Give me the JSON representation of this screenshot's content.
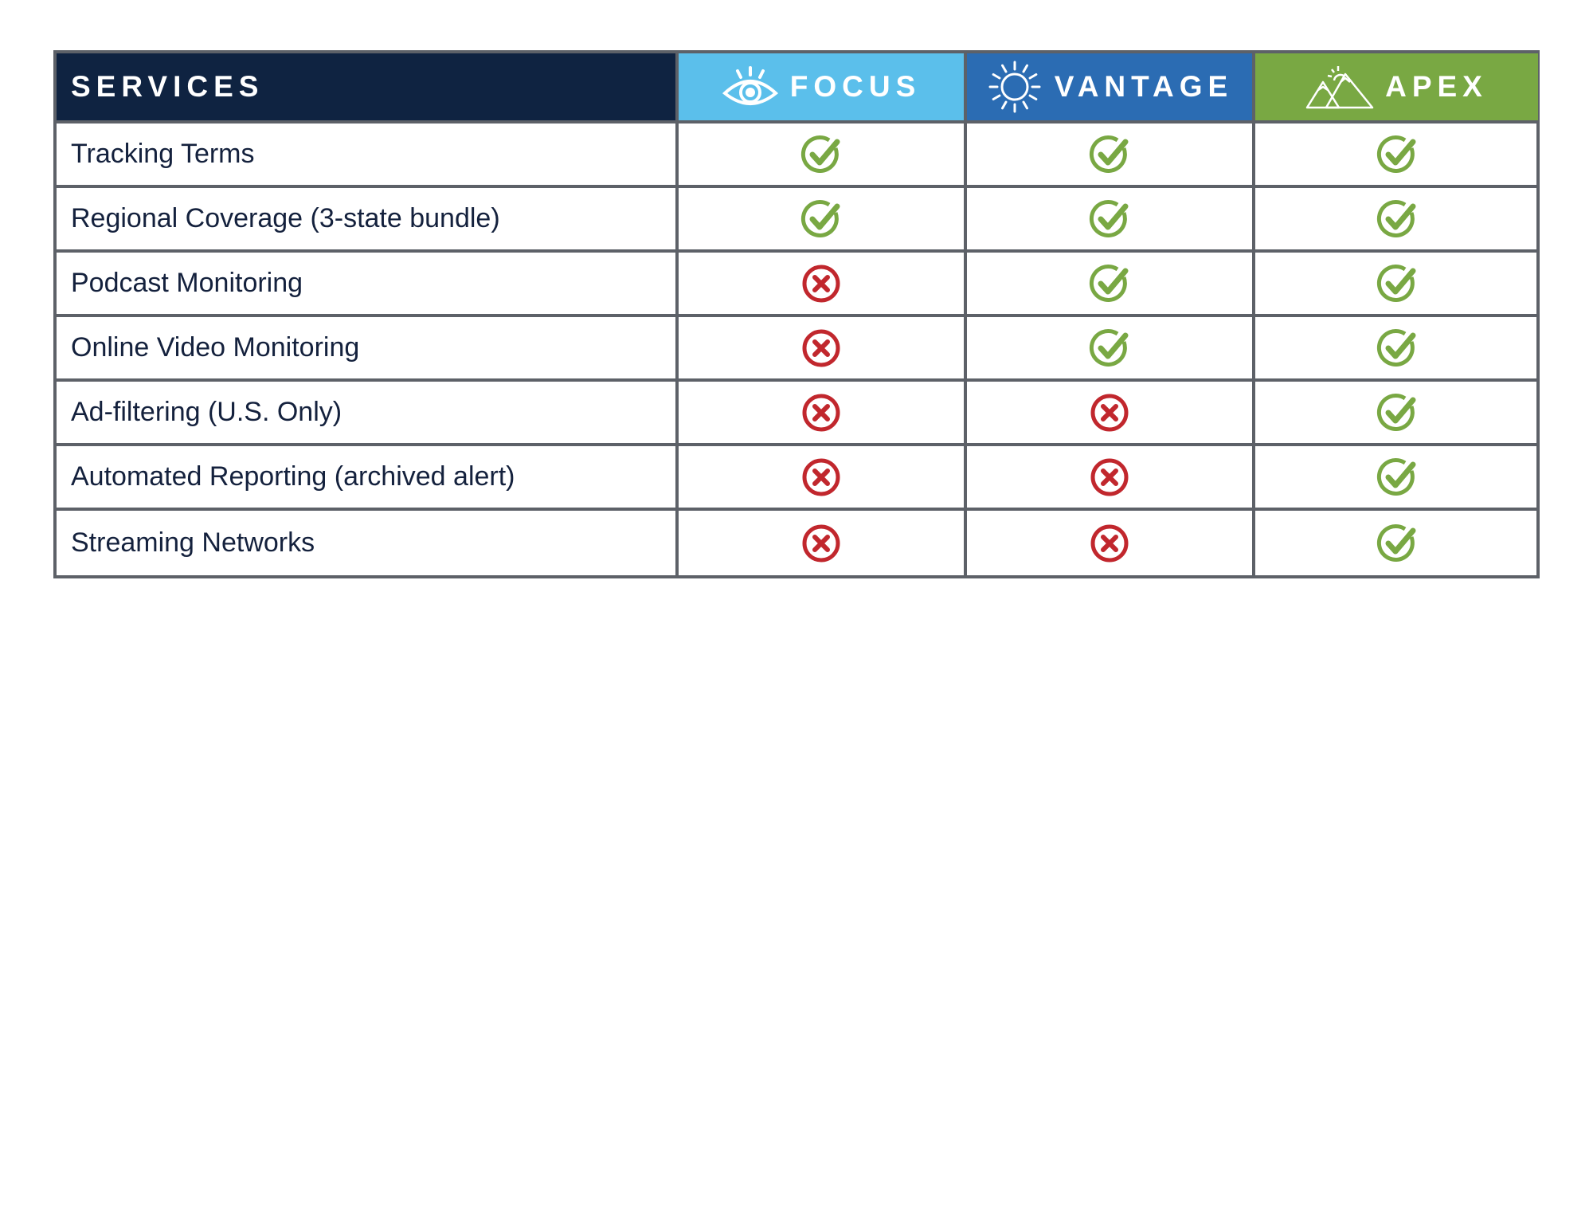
{
  "header": {
    "services": "SERVICES",
    "plans": [
      {
        "name": "FOCUS",
        "icon": "eye-icon",
        "color": "#5bbfeb"
      },
      {
        "name": "VANTAGE",
        "icon": "sun-icon",
        "color": "#2b6cb3"
      },
      {
        "name": "APEX",
        "icon": "mountains-icon",
        "color": "#79a843"
      }
    ]
  },
  "colors": {
    "services_header": "#0f2341",
    "check": "#79a843",
    "cross": "#c1272d",
    "border": "#5d6168",
    "text": "#14213d"
  },
  "rows": [
    {
      "service": "Tracking Terms",
      "focus": true,
      "vantage": true,
      "apex": true
    },
    {
      "service": "Regional Coverage (3-state bundle)",
      "focus": true,
      "vantage": true,
      "apex": true
    },
    {
      "service": "Podcast Monitoring",
      "focus": false,
      "vantage": true,
      "apex": true
    },
    {
      "service": "Online Video Monitoring",
      "focus": false,
      "vantage": true,
      "apex": true
    },
    {
      "service": "Ad-filtering (U.S. Only)",
      "focus": false,
      "vantage": false,
      "apex": true
    },
    {
      "service": "Automated Reporting (archived alert)",
      "focus": false,
      "vantage": false,
      "apex": true
    },
    {
      "service": "Streaming Networks",
      "focus": false,
      "vantage": false,
      "apex": true
    }
  ]
}
